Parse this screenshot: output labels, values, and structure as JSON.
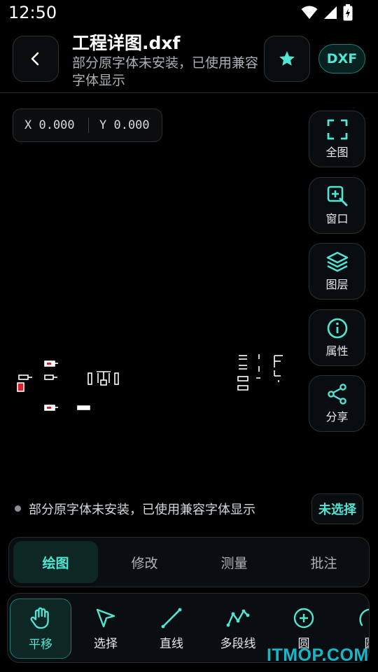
{
  "status_bar": {
    "time": "12:50"
  },
  "header": {
    "title": "工程详图.dxf",
    "subtitle": "部分原字体未安装，已使用兼容字体显示",
    "badge": "DXF"
  },
  "canvas": {
    "coord_x": "X 0.000",
    "coord_y": "Y 0.000",
    "side_buttons": [
      {
        "label": "全图",
        "icon": "fit-screen-icon"
      },
      {
        "label": "窗口",
        "icon": "zoom-window-icon"
      },
      {
        "label": "图层",
        "icon": "layers-icon"
      },
      {
        "label": "属性",
        "icon": "info-icon"
      },
      {
        "label": "分享",
        "icon": "share-icon"
      }
    ]
  },
  "status_row": {
    "message": "部分原字体未安装，已使用兼容字体显示",
    "selection": "未选择"
  },
  "tabs": [
    {
      "label": "绘图",
      "active": true
    },
    {
      "label": "修改",
      "active": false
    },
    {
      "label": "测量",
      "active": false
    },
    {
      "label": "批注",
      "active": false
    }
  ],
  "tools": [
    {
      "label": "平移",
      "icon": "hand-icon",
      "active": true
    },
    {
      "label": "选择",
      "icon": "cursor-icon",
      "active": false
    },
    {
      "label": "直线",
      "icon": "line-icon",
      "active": false
    },
    {
      "label": "多段线",
      "icon": "polyline-icon",
      "active": false
    },
    {
      "label": "圆",
      "icon": "circle-plus-icon",
      "active": false
    },
    {
      "label": "圆",
      "icon": "arc-icon",
      "active": false
    }
  ],
  "watermark": "ITMOP.COM",
  "colors": {
    "accent": "#4fe6d5",
    "accent_border": "#1b7e74",
    "accent_bg": "#0d2725",
    "drawing_red": "#e0202a"
  }
}
